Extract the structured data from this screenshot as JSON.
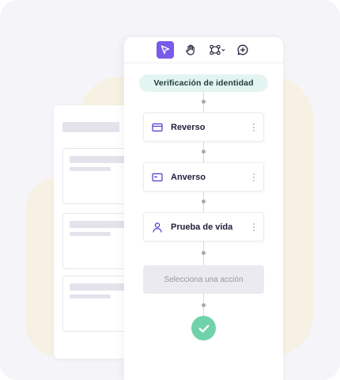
{
  "toolbar": {
    "tools": [
      {
        "name": "cursor-icon",
        "active": true
      },
      {
        "name": "hand-icon",
        "active": false
      },
      {
        "name": "node-connect-icon",
        "active": false
      },
      {
        "name": "add-comment-icon",
        "active": false
      }
    ],
    "accent_color": "#7a5ae8"
  },
  "flow": {
    "start_label": "Verificación de identidad",
    "steps": [
      {
        "label": "Reverso",
        "icon": "card-icon"
      },
      {
        "label": "Anverso",
        "icon": "id-card-icon"
      },
      {
        "label": "Prueba de vida",
        "icon": "user-icon"
      }
    ],
    "action_placeholder": "Selecciona una acción",
    "end_icon": "check-icon",
    "end_color": "#6fd2a9"
  }
}
